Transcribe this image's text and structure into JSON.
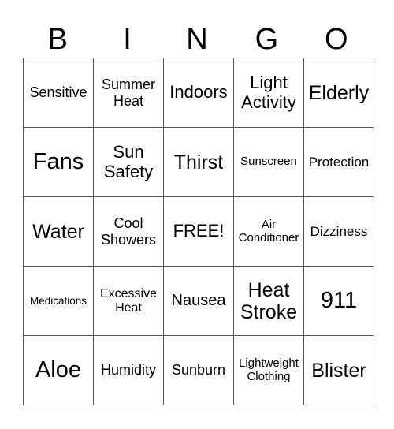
{
  "header": {
    "letters": [
      "B",
      "I",
      "N",
      "G",
      "O"
    ]
  },
  "card": {
    "rows": [
      [
        "Sensitive",
        "Summer\nHeat",
        "Indoors",
        "Light\nActivity",
        "Elderly"
      ],
      [
        "Fans",
        "Sun\nSafety",
        "Thirst",
        "Sunscreen",
        "Protection"
      ],
      [
        "Water",
        "Cool\nShowers",
        "FREE!",
        "Air\nConditioner",
        "Dizziness"
      ],
      [
        "Medications",
        "Excessive\nHeat",
        "Nausea",
        "Heat\nStroke",
        "911"
      ],
      [
        "Aloe",
        "Humidity",
        "Sunburn",
        "Lightweight\nClothing",
        "Blister"
      ]
    ]
  }
}
